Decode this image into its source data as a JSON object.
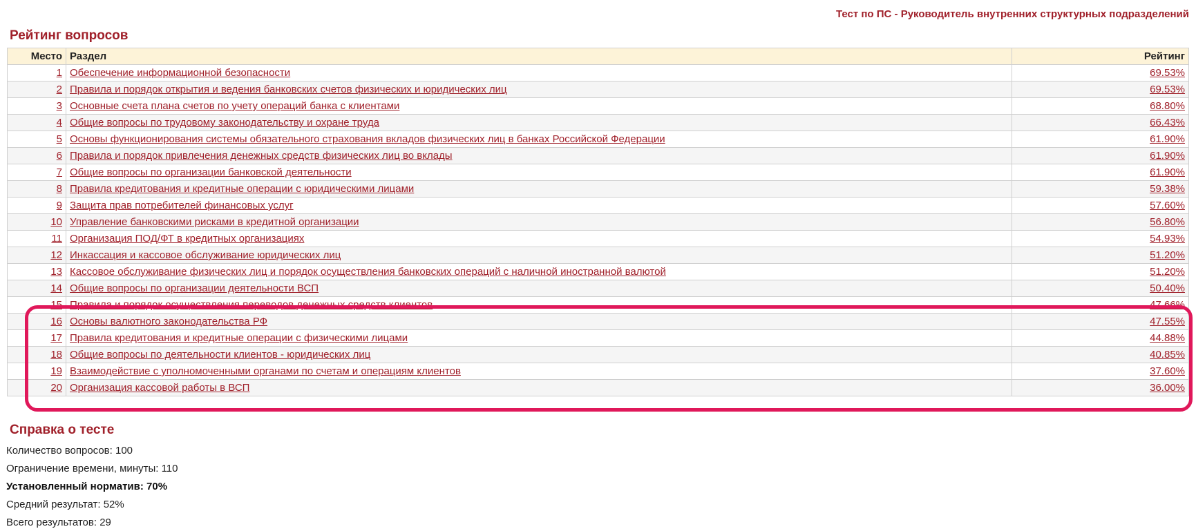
{
  "header": {
    "test_title": "Тест по ПС - Руководитель внутренних структурных подразделений"
  },
  "rating": {
    "title": "Рейтинг вопросов",
    "columns": {
      "place": "Место",
      "section": "Раздел",
      "rating": "Рейтинг"
    },
    "rows": [
      {
        "place": "1",
        "section": "Обеспечение информационной безопасности",
        "rating": "69.53%"
      },
      {
        "place": "2",
        "section": "Правила и порядок открытия и ведения банковских счетов физических и юридических лиц",
        "rating": "69.53%"
      },
      {
        "place": "3",
        "section": "Основные счета плана счетов по учету операций банка с клиентами",
        "rating": "68.80%"
      },
      {
        "place": "4",
        "section": "Общие вопросы по трудовому законодательству и охране труда",
        "rating": "66.43%"
      },
      {
        "place": "5",
        "section": "Основы функционирования системы обязательного страхования вкладов физических лиц в банках Российской Федерации",
        "rating": "61.90%"
      },
      {
        "place": "6",
        "section": "Правила и порядок привлечения денежных средств физических лиц во вклады",
        "rating": "61.90%"
      },
      {
        "place": "7",
        "section": "Общие вопросы по организации банковской деятельности",
        "rating": "61.90%"
      },
      {
        "place": "8",
        "section": "Правила кредитования и кредитные операции с юридическими лицами",
        "rating": "59.38%"
      },
      {
        "place": "9",
        "section": "Защита прав потребителей финансовых услуг",
        "rating": "57.60%"
      },
      {
        "place": "10",
        "section": "Управление банковскими рисками в кредитной организации",
        "rating": "56.80%"
      },
      {
        "place": "11",
        "section": "Организация ПОД/ФТ в кредитных организациях",
        "rating": "54.93%"
      },
      {
        "place": "12",
        "section": "Инкассация и кассовое обслуживание юридических лиц",
        "rating": "51.20%"
      },
      {
        "place": "13",
        "section": "Кассовое обслуживание физических лиц и порядок осуществления банковских операций с наличной иностранной валютой",
        "rating": "51.20%"
      },
      {
        "place": "14",
        "section": "Общие вопросы по организации деятельности ВСП",
        "rating": "50.40%"
      },
      {
        "place": "15",
        "section": "Правила и порядок осуществления переводов денежных средств клиентов",
        "rating": "47.66%"
      },
      {
        "place": "16",
        "section": "Основы валютного законодательства РФ",
        "rating": "47.55%"
      },
      {
        "place": "17",
        "section": "Правила кредитования и кредитные операции с физическими лицами",
        "rating": "44.88%"
      },
      {
        "place": "18",
        "section": "Общие вопросы по деятельности клиентов - юридических лиц",
        "rating": "40.85%"
      },
      {
        "place": "19",
        "section": "Взаимодействие с уполномоченными органами по счетам и операциям клиентов",
        "rating": "37.60%"
      },
      {
        "place": "20",
        "section": "Организация кассовой работы в ВСП",
        "rating": "36.00%"
      }
    ]
  },
  "info": {
    "title": "Справка о тесте",
    "questions_count": "Количество вопросов: 100",
    "time_limit": "Ограничение времени, минуты: 110",
    "norm": "Установленный норматив: 70%",
    "avg_result": "Средний результат: 52%",
    "total_results": "Всего результатов: 29"
  },
  "colors": {
    "accent": "#a0202a",
    "header_bg": "#fdf3d8",
    "highlight": "#e0185a"
  }
}
